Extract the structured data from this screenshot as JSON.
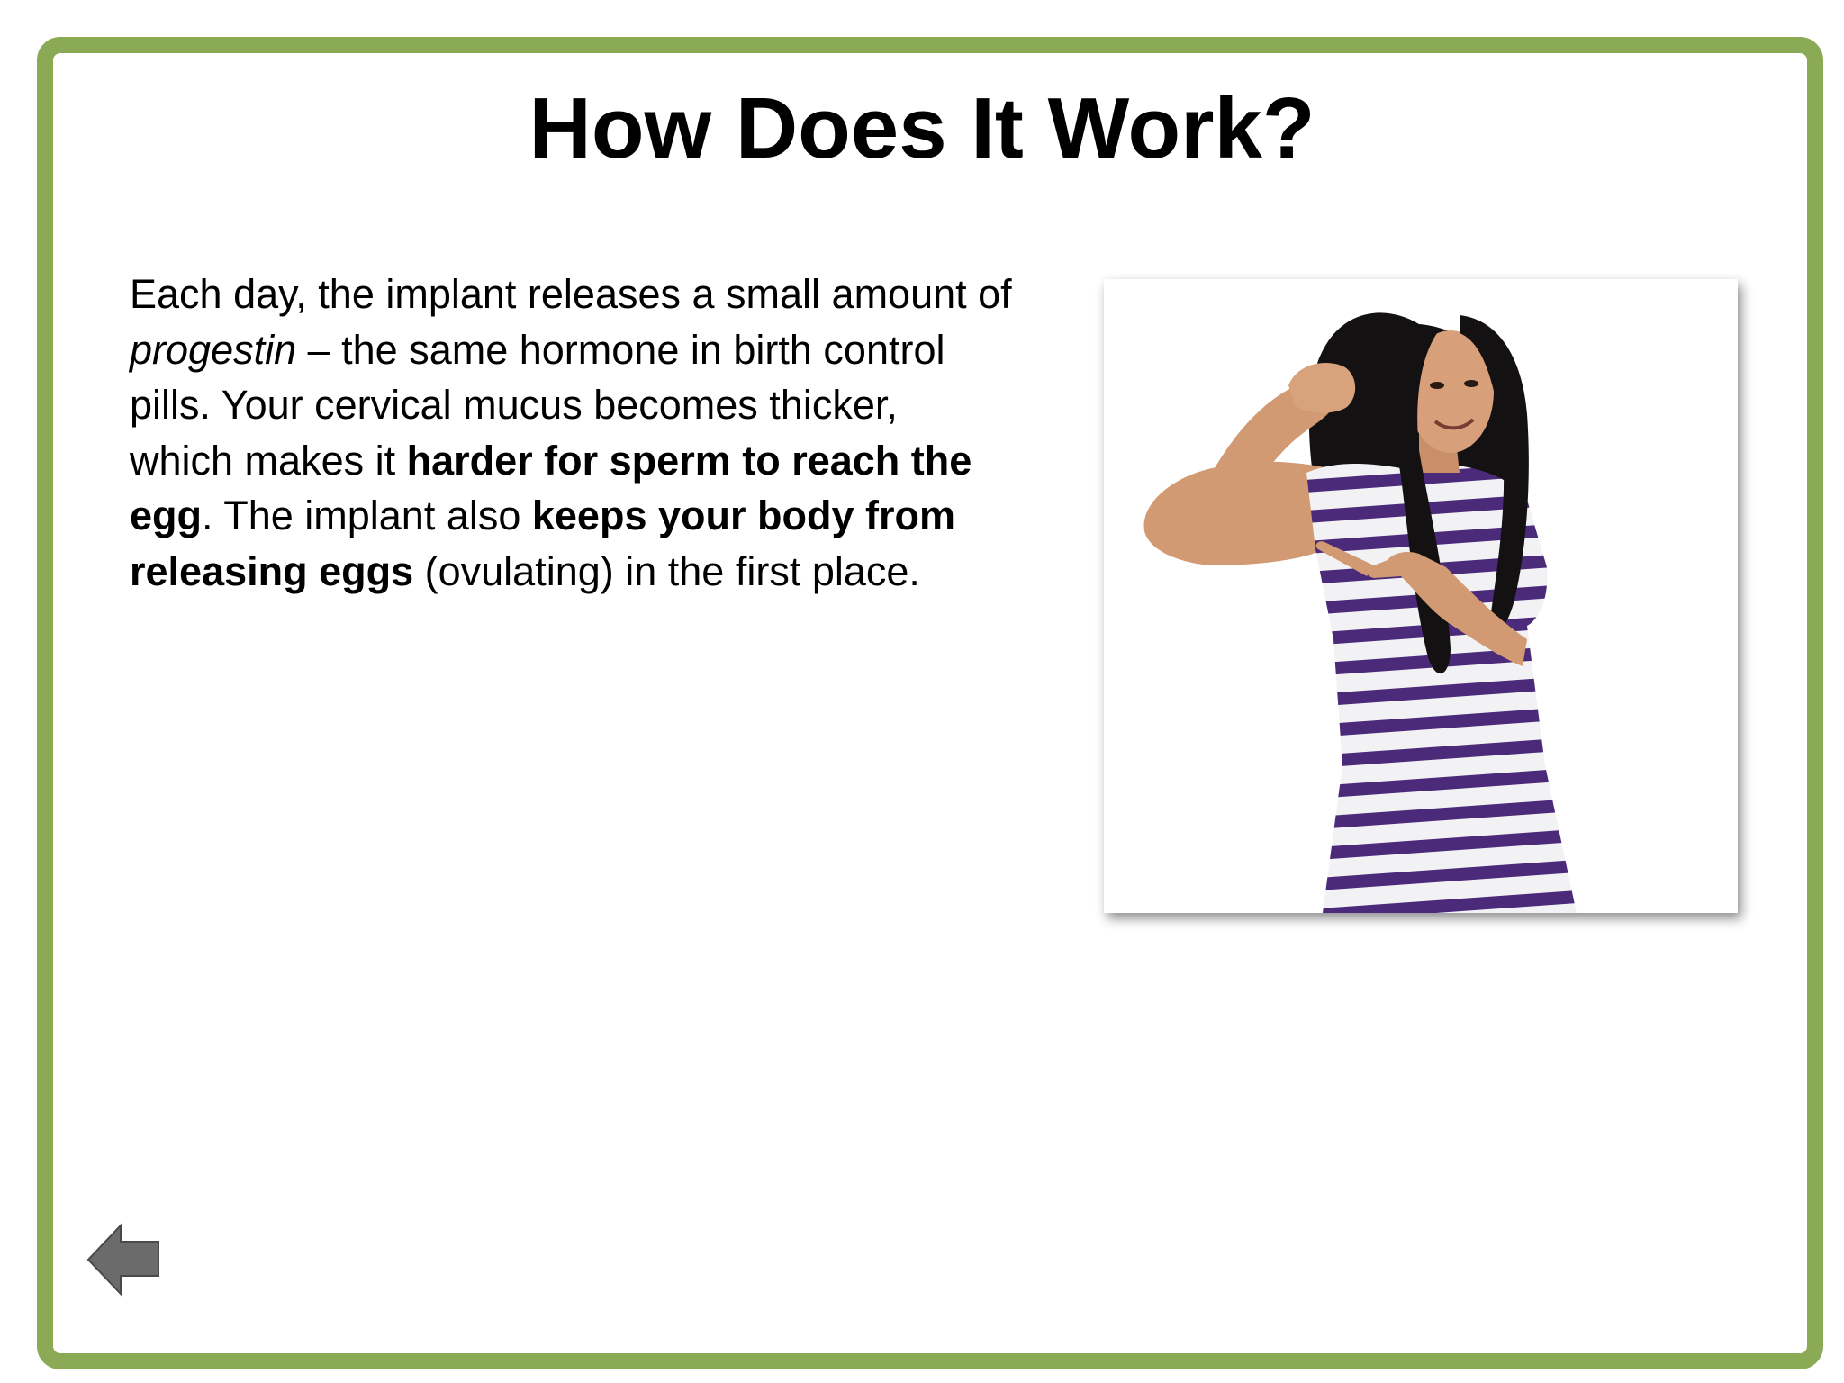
{
  "slide": {
    "title": "How Does It Work?",
    "paragraph": {
      "seg1": "Each day, the implant releases a small amount of ",
      "seg2_italic": "progestin",
      "seg3": " – the same hormone in birth control pills. Your cervical mucus becomes thicker, which makes it ",
      "seg4_bold": "harder for sperm to reach the egg",
      "seg5": ". The implant also ",
      "seg6_bold": "keeps your body from releasing eggs",
      "seg7": " (ovulating) in the first place."
    },
    "photo": {
      "subject": "young woman in purple-and-white striped top flexing her arm and pointing to her upper arm"
    }
  },
  "navigation": {
    "back_icon": "left-arrow-icon"
  },
  "colors": {
    "frame_border": "#8aaa55",
    "background": "#ffffff",
    "text": "#000000",
    "back_arrow": "#6b6b6b",
    "stripe_purple": "#4b2a7a"
  }
}
